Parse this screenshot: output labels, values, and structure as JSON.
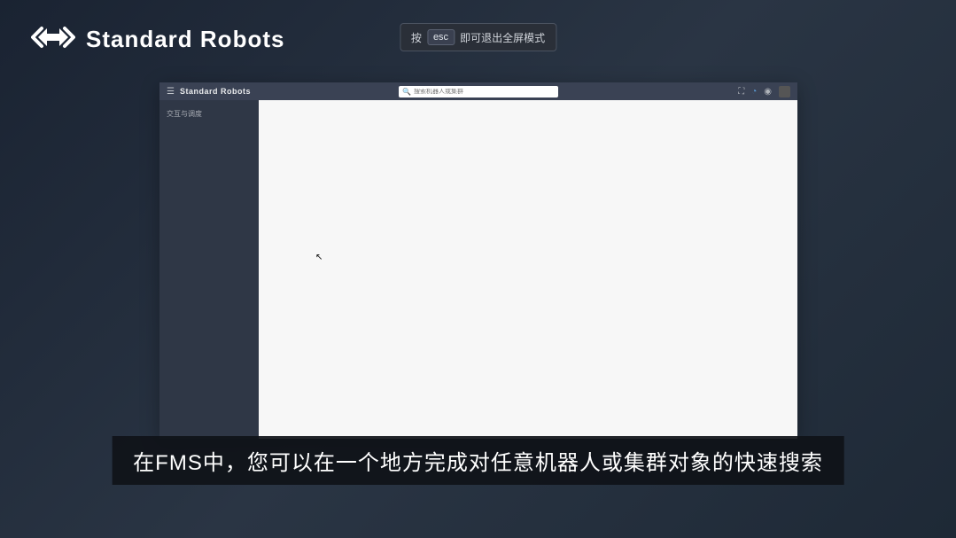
{
  "brand": {
    "name": "Standard Robots"
  },
  "esc_hint": {
    "prefix": "按",
    "key": "esc",
    "suffix": "即可退出全屏模式"
  },
  "app": {
    "title": "Standard Robots",
    "search_placeholder": "搜索机器人或集群",
    "sidebar": {
      "items": [
        {
          "label": "交互与调度"
        }
      ]
    }
  },
  "subtitle": "在FMS中，您可以在一个地方完成对任意机器人或集群对象的快速搜索"
}
